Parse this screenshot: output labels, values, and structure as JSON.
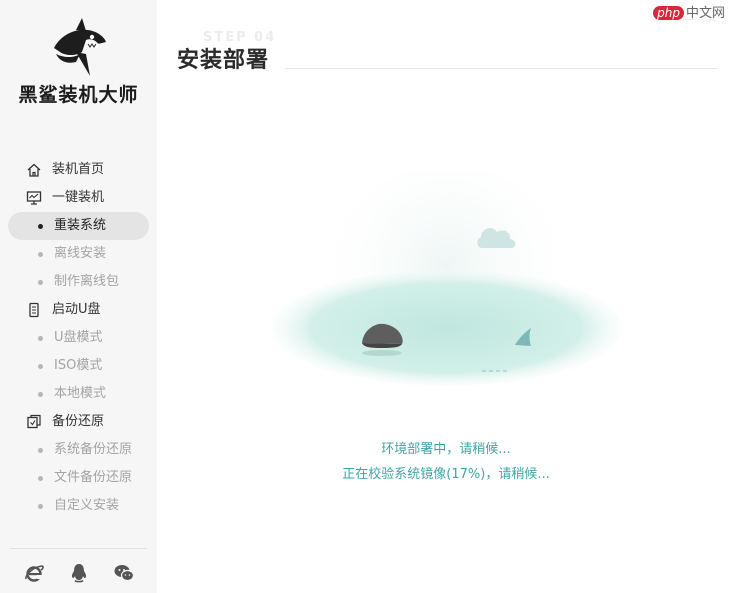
{
  "brand": {
    "name": "黑鲨装机大师",
    "logo_icon": "shark-logo-icon"
  },
  "sidebar": {
    "items": [
      {
        "name": "nav-home",
        "icon": "home-icon",
        "label": "装机首页"
      },
      {
        "name": "nav-oneclick",
        "icon": "monitor-icon",
        "label": "一键装机",
        "children": [
          {
            "label": "重装系统",
            "active": true
          },
          {
            "label": "离线安装"
          },
          {
            "label": "制作离线包"
          }
        ]
      },
      {
        "name": "nav-usb",
        "icon": "usb-drive-icon",
        "label": "启动U盘",
        "children": [
          {
            "label": "U盘模式"
          },
          {
            "label": "ISO模式"
          },
          {
            "label": "本地模式"
          }
        ]
      },
      {
        "name": "nav-backup",
        "icon": "backup-icon",
        "label": "备份还原",
        "children": [
          {
            "label": "系统备份还原"
          },
          {
            "label": "文件备份还原"
          },
          {
            "label": "自定义安装"
          }
        ]
      }
    ],
    "bottom_icons": [
      "ie-browser-icon",
      "qq-penguin-icon",
      "wechat-icon"
    ]
  },
  "header": {
    "title": "安装部署",
    "watermark": "STEP 04",
    "window_controls": [
      "minimize",
      "close"
    ],
    "site_badge": {
      "prefix": "php",
      "text": "中文网"
    }
  },
  "status": {
    "line1": "环境部署中，请稍候...",
    "line2": "正在校验系统镜像(17%)，请稍候..."
  },
  "colors": {
    "status_text": "#3fa6a6",
    "sea": "#bfe7df",
    "sidebar_bg": "#f6f6f6"
  }
}
